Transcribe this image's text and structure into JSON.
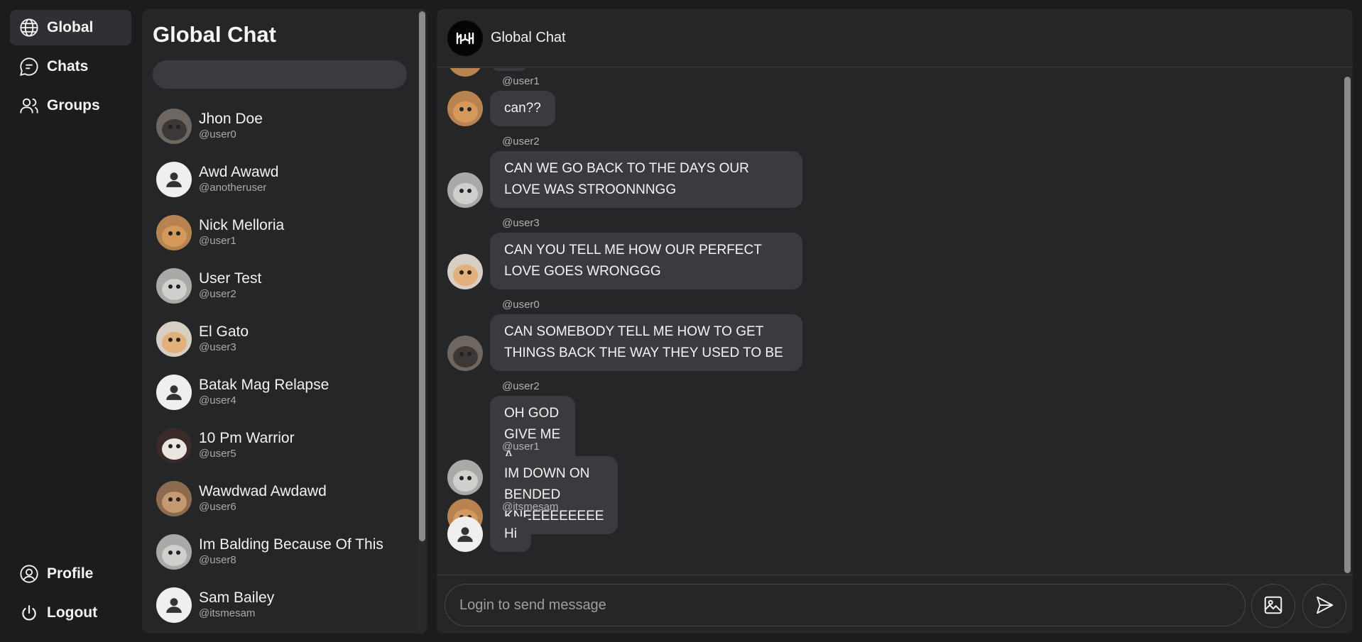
{
  "nav": {
    "items": [
      {
        "label": "Global",
        "icon": "globe-icon",
        "active": true
      },
      {
        "label": "Chats",
        "icon": "chat-bubble-icon"
      },
      {
        "label": "Groups",
        "icon": "users-icon"
      }
    ],
    "bottom": [
      {
        "label": "Profile",
        "icon": "user-circle-icon"
      },
      {
        "label": "Logout",
        "icon": "power-icon"
      }
    ]
  },
  "list": {
    "title": "Global Chat",
    "search_placeholder": "",
    "users": [
      {
        "name": "Jhon Doe",
        "handle": "@user0",
        "avatar": "photo"
      },
      {
        "name": "Awd Awawd",
        "handle": "@anotheruser",
        "avatar": "default"
      },
      {
        "name": "Nick Melloria",
        "handle": "@user1",
        "avatar": "photo"
      },
      {
        "name": "User Test",
        "handle": "@user2",
        "avatar": "photo"
      },
      {
        "name": "El Gato",
        "handle": "@user3",
        "avatar": "photo"
      },
      {
        "name": "Batak Mag Relapse",
        "handle": "@user4",
        "avatar": "default"
      },
      {
        "name": "10 Pm Warrior",
        "handle": "@user5",
        "avatar": "photo"
      },
      {
        "name": "Wawdwad Awdawd",
        "handle": "@user6",
        "avatar": "photo"
      },
      {
        "name": "Im Balding Because Of This",
        "handle": "@user8",
        "avatar": "photo"
      },
      {
        "name": "Sam Bailey",
        "handle": "@itsmesam",
        "avatar": "default"
      }
    ]
  },
  "chat": {
    "title": "Global Chat",
    "messages": [
      {
        "handle": "@user1",
        "text": "can??"
      },
      {
        "handle": "@user2",
        "text": "CAN WE GO BACK TO THE DAYS OUR LOVE WAS STROONNNGG"
      },
      {
        "handle": "@user3",
        "text": "CAN YOU TELL ME HOW OUR PERFECT LOVE GOES WRONGGG"
      },
      {
        "handle": "@user0",
        "text": "CAN SOMEBODY TELL ME HOW TO GET THINGS BACK THE WAY THEY USED TO BE"
      },
      {
        "handle": "@user2",
        "text": "OH GOD GIVE ME A REASON"
      },
      {
        "handle": "@user1",
        "text": "IM DOWN ON BENDED KNEEEEEEEEE"
      },
      {
        "handle": "@itsmesam",
        "text": "Hi"
      }
    ],
    "composer_placeholder": "Login to send message"
  }
}
